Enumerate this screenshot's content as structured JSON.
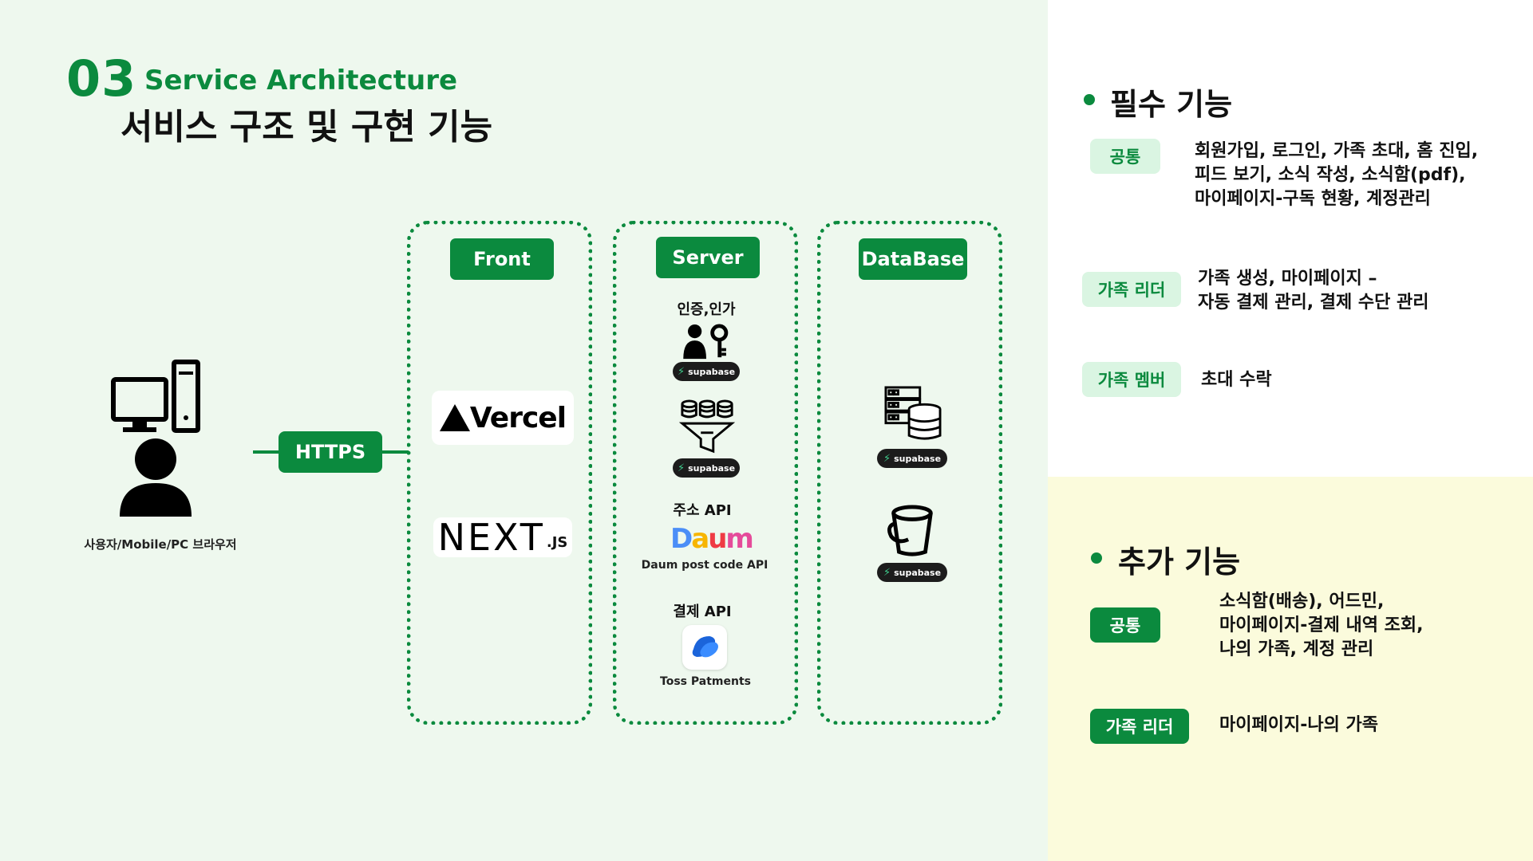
{
  "section": {
    "number": "03",
    "title_en": "Service Architecture",
    "title_ko": "서비스 구조 및 구현 기능"
  },
  "client": {
    "label": "사용자/Mobile/PC 브라우저",
    "protocol": "HTTPS"
  },
  "columns": {
    "front": {
      "header": "Front",
      "items": [
        {
          "name": "Vercel",
          "icon": "vercel-logo"
        },
        {
          "name": "NEXT",
          "suffix": ".JS",
          "icon": "nextjs-logo"
        }
      ]
    },
    "server": {
      "header": "Server",
      "auth_title": "인증,인가",
      "supabase_label": "supabase",
      "address_title": "주소 API",
      "daum_caption": "Daum post code API",
      "payment_title": "결제 API",
      "toss_caption": "Toss Patments",
      "icons": [
        "auth-user-key-icon",
        "database-filter-icon",
        "daum-logo",
        "toss-logo"
      ]
    },
    "database": {
      "header": "DataBase",
      "supabase_label": "supabase",
      "icons": [
        "server-database-icon",
        "storage-bucket-icon"
      ]
    }
  },
  "required": {
    "heading": "필수 기능",
    "rows": [
      {
        "tag": "공통",
        "text": "회원가입, 로그인, 가족 초대, 홈 진입,\n피드 보기, 소식 작성, 소식함(pdf),\n마이페이지-구독 현황, 계정관리"
      },
      {
        "tag": "가족 리더",
        "text": "가족 생성, 마이페이지 –\n자동 결제 관리, 결제 수단 관리"
      },
      {
        "tag": "가족 멤버",
        "text": "초대 수락"
      }
    ]
  },
  "additional": {
    "heading": "추가 기능",
    "rows": [
      {
        "tag": "공통",
        "text": "소식함(배송), 어드민,\n마이페이지-결제 내역 조회,\n나의 가족, 계정 관리"
      },
      {
        "tag": "가족 리더",
        "text": "마이페이지-나의 가족"
      }
    ]
  },
  "colors": {
    "brand_green": "#0b8a3e",
    "left_bg": "#eef8ee",
    "bottom_right_bg": "#fbfbdc",
    "tag_light_bg": "#daf5e2",
    "supabase_green": "#3ecf8e"
  }
}
